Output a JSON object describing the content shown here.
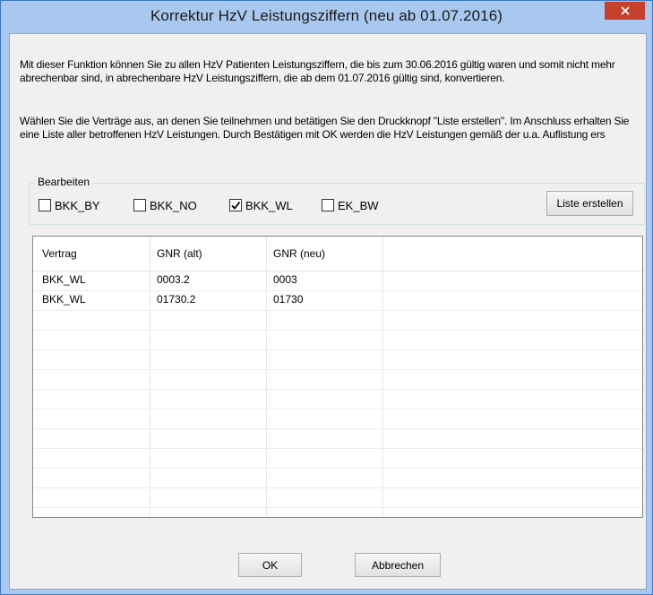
{
  "window": {
    "title": "Korrektur HzV Leistungsziffern (neu ab 01.07.2016)",
    "close_icon": "close-icon",
    "accent": "#a9c8ef",
    "close_color": "#c7402c"
  },
  "description": {
    "p1": "Mit dieser Funktion können Sie zu allen HzV Patienten Leistungsziffern, die bis zum 30.06.2016 gültig waren und somit nicht mehr abrechenbar sind, in abrechenbare HzV Leistungsziffern, die ab dem 01.07.2016 gültig sind, konvertieren.",
    "p2": "Wählen Sie die Verträge aus, an denen Sie teilnehmen und betätigen Sie den Druckknopf \"Liste erstellen\". Im Anschluss erhalten Sie eine Liste aller betroffenen HzV Leistungen. Durch Bestätigen mit OK werden die HzV Leistungen gemäß der u.a. Auflistung ers"
  },
  "group": {
    "label": "Bearbeiten",
    "checkboxes": [
      {
        "label": "BKK_BY",
        "checked": false
      },
      {
        "label": "BKK_NO",
        "checked": false
      },
      {
        "label": "BKK_WL",
        "checked": true
      },
      {
        "label": "EK_BW",
        "checked": false
      }
    ],
    "create_list_button": "Liste erstellen"
  },
  "table": {
    "columns": [
      "Vertrag",
      "GNR (alt)",
      "GNR (neu)"
    ],
    "rows": [
      [
        "BKK_WL",
        "0003.2",
        "0003"
      ],
      [
        "BKK_WL",
        "01730.2",
        "01730"
      ]
    ]
  },
  "footer": {
    "ok_label": "OK",
    "cancel_label": "Abbrechen"
  }
}
